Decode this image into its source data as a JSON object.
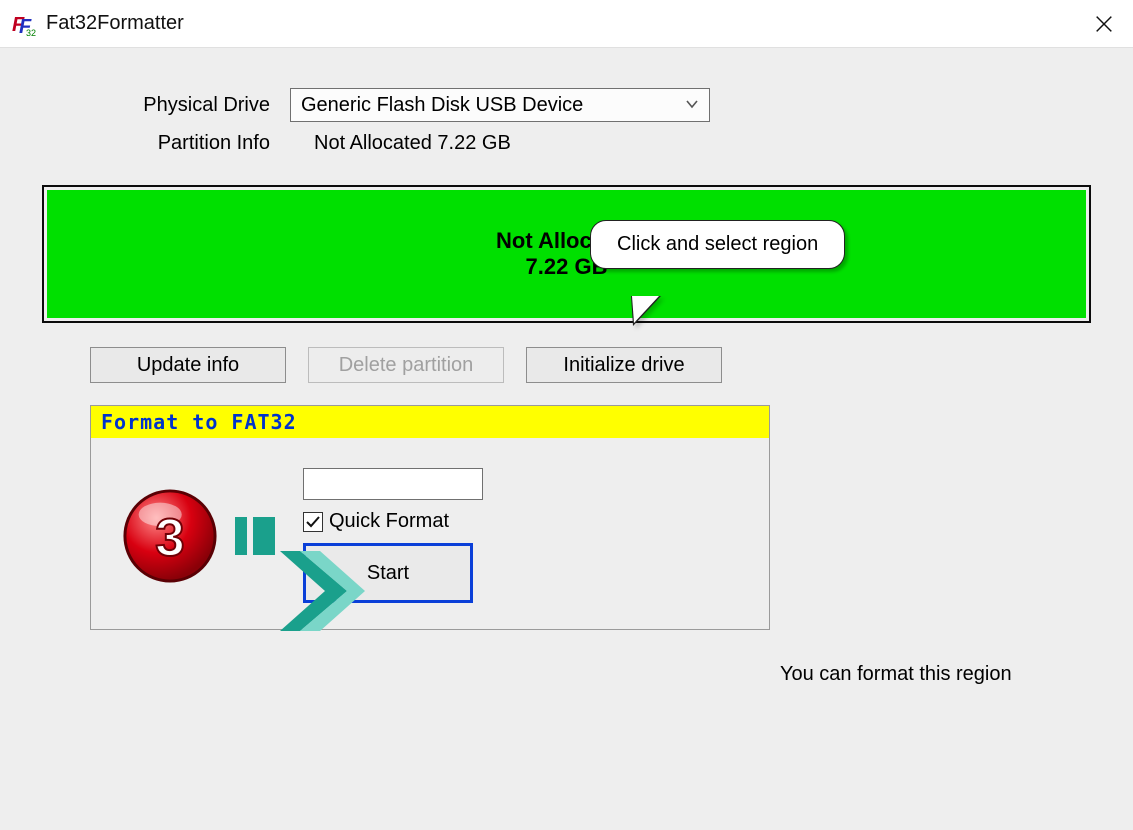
{
  "window": {
    "title": "Fat32Formatter"
  },
  "labels": {
    "physical_drive": "Physical Drive",
    "partition_info": "Partition Info"
  },
  "drive": {
    "selected": "Generic Flash Disk USB Device"
  },
  "partition": {
    "summary": "Not Allocated  7.22 GB",
    "region_title": "Not Allocated",
    "region_size": "7.22 GB"
  },
  "callout": {
    "text": "Click and select region"
  },
  "buttons": {
    "update": "Update info",
    "delete": "Delete partition",
    "initialize": "Initialize drive"
  },
  "format": {
    "panel_title": "Format to FAT32",
    "volume_label": "",
    "quick_label": "Quick Format",
    "quick_checked": true,
    "start": "Start"
  },
  "hint": "You can format this region"
}
